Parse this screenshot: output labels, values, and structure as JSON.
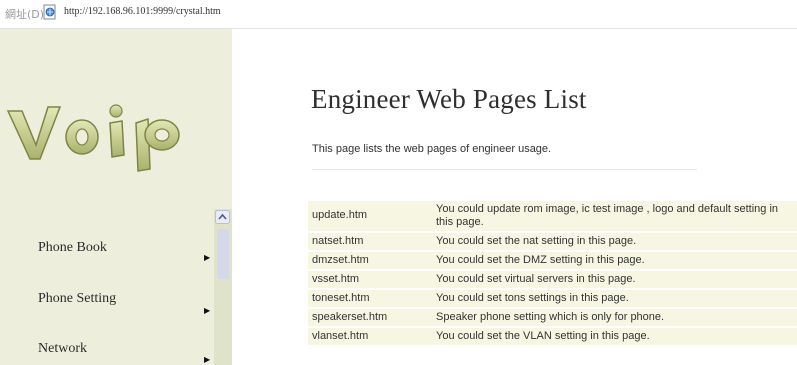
{
  "address_bar": {
    "label": "網址(D)",
    "url": "http://192.168.96.101:9999/crystal.htm"
  },
  "sidebar": {
    "logo_text": "VOIP",
    "menu": [
      {
        "label": "Phone Book"
      },
      {
        "label": "Phone Setting"
      },
      {
        "label": "Network"
      }
    ]
  },
  "main": {
    "title": "Engineer Web Pages List",
    "description": "This page lists the web pages of engineer usage.",
    "pages": [
      {
        "page": "update.htm",
        "description": "You could update rom image, ic test image , logo and default setting in this page."
      },
      {
        "page": "natset.htm",
        "description": "You could set the nat setting in this page."
      },
      {
        "page": "dmzset.htm",
        "description": "You could set the DMZ setting in this page."
      },
      {
        "page": "vsset.htm",
        "description": "You could set virtual servers in this page."
      },
      {
        "page": "toneset.htm",
        "description": "You could set tons settings in this page."
      },
      {
        "page": "speakerset.htm",
        "description": "Speaker phone setting which is only for phone."
      },
      {
        "page": "vlanset.htm",
        "description": "You could set the VLAN setting in this page."
      }
    ]
  },
  "colors": {
    "sidebar_bg": "#edefdc",
    "row_bg": "#f7f6e3",
    "logo": "#c7cf98"
  }
}
